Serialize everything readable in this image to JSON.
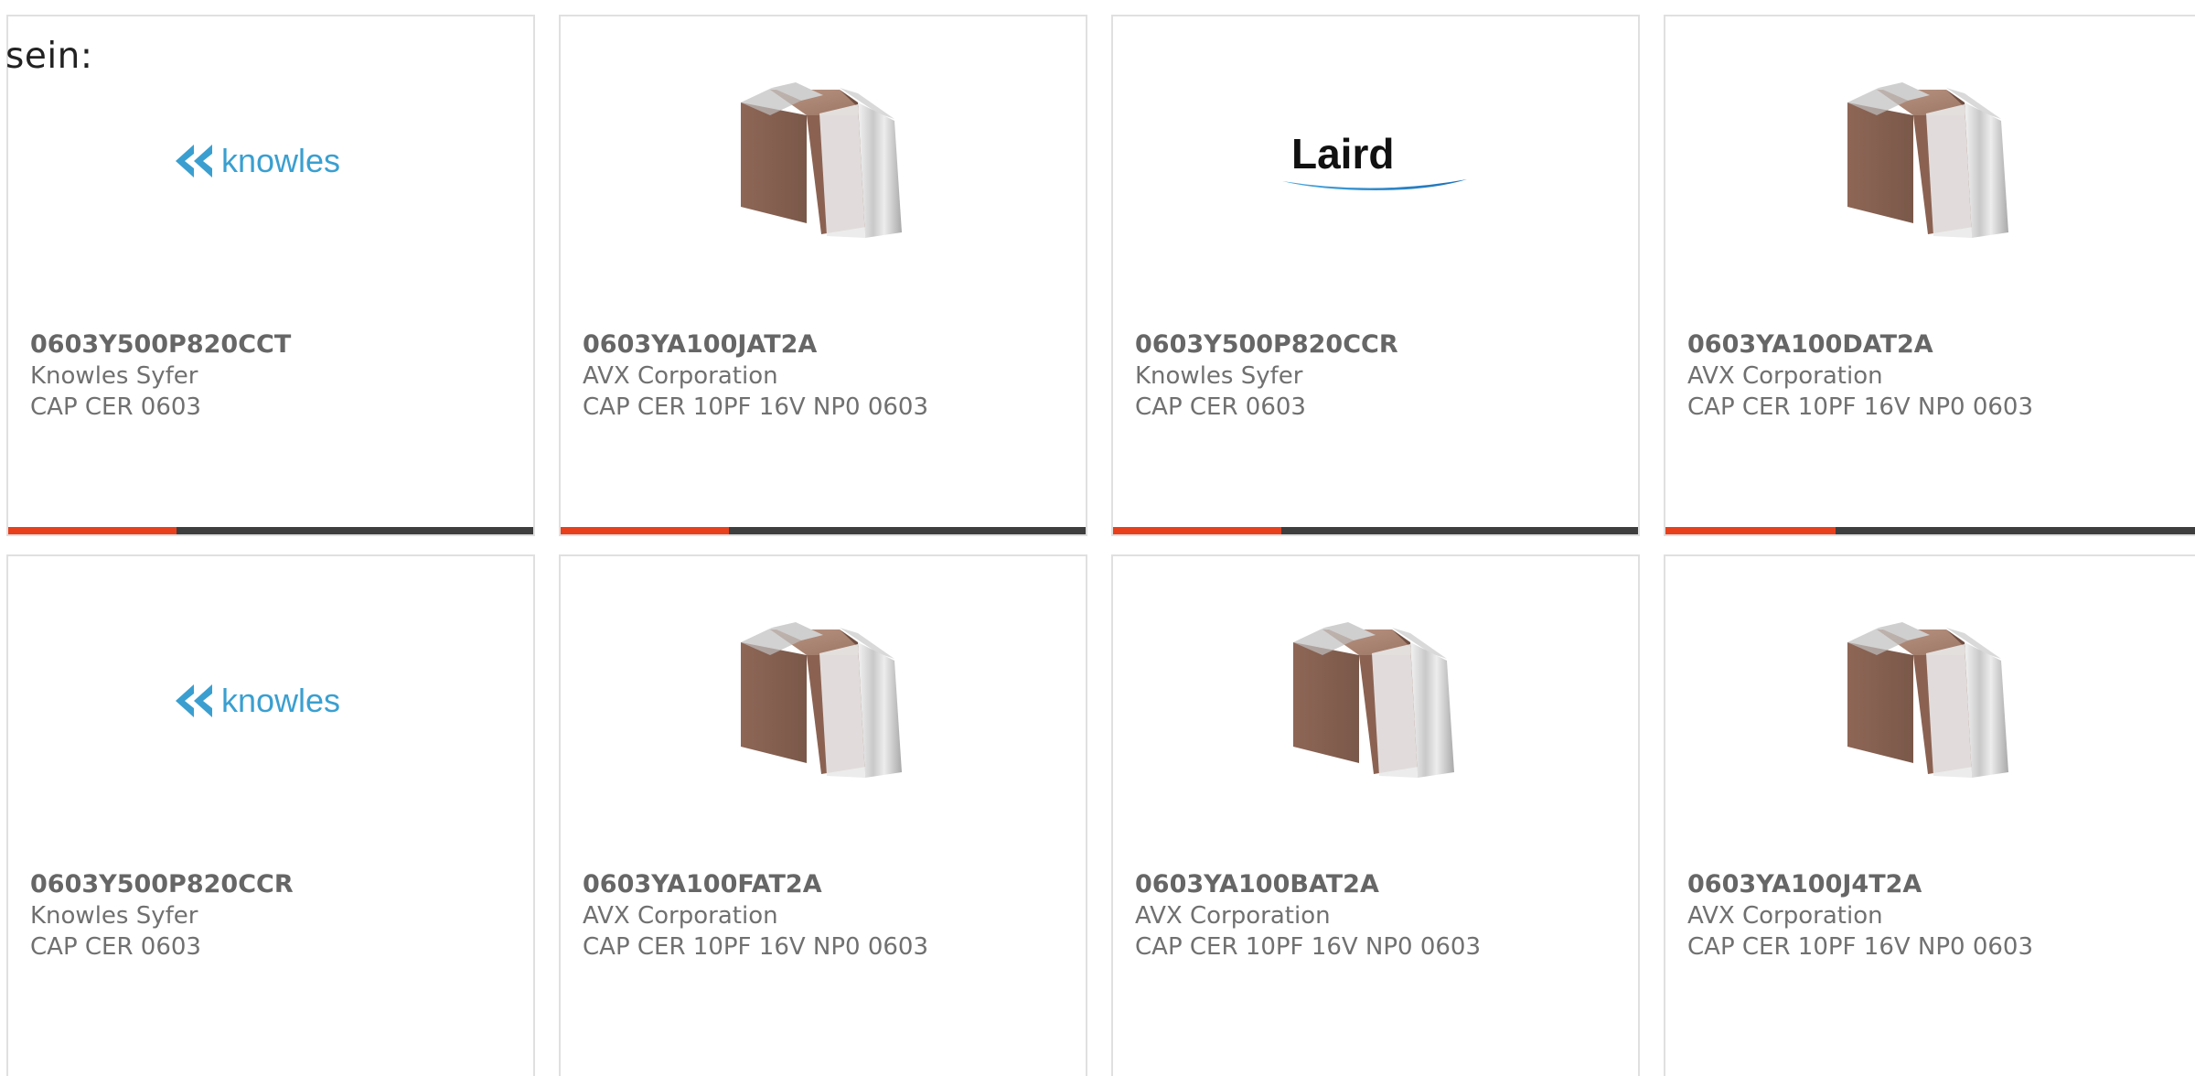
{
  "prefix_text": "sein:",
  "colors": {
    "accent_bar": "#e8401c",
    "track_bar": "#3e3e3e",
    "card_border": "#e0e0e0",
    "knowles_blue": "#3a9fd0"
  },
  "products": [
    {
      "part_number": "0603Y500P820CCT",
      "manufacturer": "Knowles Syfer",
      "description": "CAP CER 0603",
      "image": "knowles-logo",
      "logo_text": "knowles",
      "progress": 0.32
    },
    {
      "part_number": "0603YA100JAT2A",
      "manufacturer": "AVX Corporation",
      "description": "CAP CER 10PF 16V NP0 0603",
      "image": "ceramic-capacitor-chip",
      "progress": 0.32
    },
    {
      "part_number": "0603Y500P820CCR",
      "manufacturer": "Knowles Syfer",
      "description": "CAP CER 0603",
      "image": "laird-logo",
      "logo_text": "Laird",
      "progress": 0.32
    },
    {
      "part_number": "0603YA100DAT2A",
      "manufacturer": "AVX Corporation",
      "description": "CAP CER 10PF 16V NP0 0603",
      "image": "ceramic-capacitor-chip",
      "progress": 0.32
    },
    {
      "part_number": "0603Y500P820CCR",
      "manufacturer": "Knowles Syfer",
      "description": "CAP CER 0603",
      "image": "knowles-logo",
      "logo_text": "knowles"
    },
    {
      "part_number": "0603YA100FAT2A",
      "manufacturer": "AVX Corporation",
      "description": "CAP CER 10PF 16V NP0 0603",
      "image": "ceramic-capacitor-chip"
    },
    {
      "part_number": "0603YA100BAT2A",
      "manufacturer": "AVX Corporation",
      "description": "CAP CER 10PF 16V NP0 0603",
      "image": "ceramic-capacitor-chip"
    },
    {
      "part_number": "0603YA100J4T2A",
      "manufacturer": "AVX Corporation",
      "description": "CAP CER 10PF 16V NP0 0603",
      "image": "ceramic-capacitor-chip"
    }
  ]
}
